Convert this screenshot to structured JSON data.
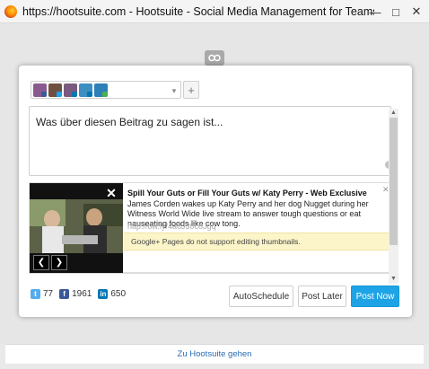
{
  "window": {
    "title": "https://hootsuite.com - Hootsuite - Social Media Management for Teams using...",
    "minimize_glyph": "—",
    "maximize_glyph": "□",
    "close_glyph": "✕"
  },
  "icons": {
    "browser": "firefox-icon",
    "logo": "hootsuite-owl-icon",
    "dropdown": "chevron-down-icon",
    "add": "plus-icon"
  },
  "composer": {
    "profiles": [
      {
        "name": "profile-1",
        "network": "facebook",
        "color": "#8a5a8f",
        "badge": "#3b5998"
      },
      {
        "name": "profile-2",
        "network": "twitter",
        "color": "#6f4f3f",
        "badge": "#1da1f2"
      },
      {
        "name": "profile-3",
        "network": "linkedin",
        "color": "#7a5a7f",
        "badge": "#0077b5"
      },
      {
        "name": "profile-4",
        "network": "linkedin",
        "color": "#3c8fc0",
        "badge": "#0077b5"
      },
      {
        "name": "profile-5",
        "network": "google-plus",
        "color": "#2c7fb8",
        "badge": "#4caf50"
      }
    ],
    "add_label": "+",
    "dropdown_glyph": "▾",
    "message_placeholder": "Was über diesen Beitrag zu sagen ist..."
  },
  "link_preview": {
    "title": "Spill Your Guts or Fill Your Guts w/ Katy Perry - Web Exclusive",
    "description": "James Corden wakes up Katy Perry and her dog Nugget during her Witness World Wide live stream to answer tough questions or eat nauseating foods like cow tong.",
    "url": "http://ow.ly/4a6J30c8Jgq",
    "notice": "Google+ Pages do not support editing thumbnails.",
    "close_glyph": "✕",
    "thumb_close_glyph": "✕",
    "prev_glyph": "❮",
    "next_glyph": "❯"
  },
  "counts": [
    {
      "network": "twitter",
      "letter": "t",
      "value": "77",
      "color": "#55acee"
    },
    {
      "network": "facebook",
      "letter": "f",
      "value": "1961",
      "color": "#3b5998"
    },
    {
      "network": "linkedin",
      "letter": "in",
      "value": "650",
      "color": "#0077b5"
    }
  ],
  "actions": {
    "autoschedule": "AutoSchedule",
    "post_later": "Post Later",
    "post_now": "Post Now"
  },
  "footer": {
    "link": "Zu Hootsuite gehen"
  },
  "colors": {
    "accent": "#1ea4e6",
    "notice_bg": "#fcf5c9"
  }
}
